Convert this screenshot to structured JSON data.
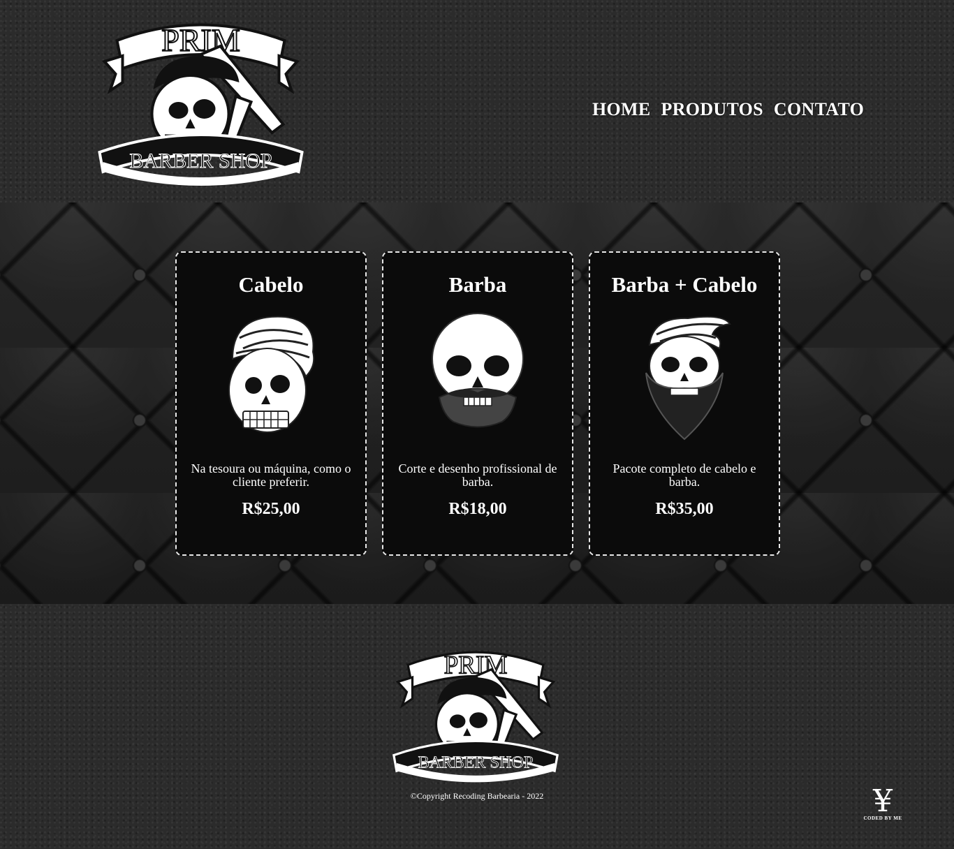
{
  "header": {
    "logo": {
      "top_text": "PRIM",
      "bottom_text": "BARBER SHOP",
      "icon": "skull-barber-logo"
    },
    "nav": [
      {
        "label": "HOME"
      },
      {
        "label": "PRODUTOS"
      },
      {
        "label": "CONTATO"
      }
    ]
  },
  "products": [
    {
      "title": "Cabelo",
      "image": "skull-pompadour-icon",
      "description": "Na tesoura ou máquina, como o cliente preferir.",
      "price": "R$25,00"
    },
    {
      "title": "Barba",
      "image": "skull-mustache-icon",
      "description": "Corte e desenho profissional de barba.",
      "price": "R$18,00"
    },
    {
      "title": "Barba + Cabelo",
      "image": "skull-beard-hair-icon",
      "description": "Pacote completo de cabelo e barba.",
      "price": "R$35,00"
    }
  ],
  "footer": {
    "logo": {
      "top_text": "PRIM",
      "bottom_text": "BARBER SHOP",
      "icon": "skull-barber-logo"
    },
    "copyright": "©Copyright Recoding Barbearia - 2022",
    "coded_by": {
      "symbol": "¥",
      "text": "CODED BY ME"
    }
  },
  "colors": {
    "text": "#ffffff",
    "card_bg": "#0b0b0b",
    "card_border": "#e8e8e8",
    "page_bg": "#2b2b2b"
  }
}
